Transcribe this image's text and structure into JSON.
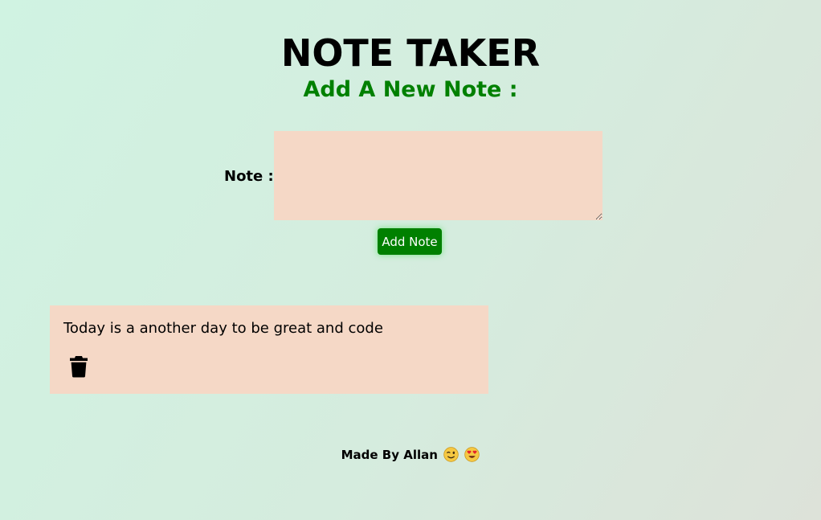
{
  "header": {
    "title": "NOTE TAKER",
    "subtitle": "Add A New Note :"
  },
  "form": {
    "note_label": "Note :",
    "note_value": "",
    "add_button_label": "Add Note"
  },
  "notes": [
    {
      "text": "Today is a another day to be great and code",
      "delete_icon": "trash-icon"
    }
  ],
  "footer": {
    "text": "Made By Allan",
    "emojis": [
      "winking-face-emoji",
      "heart-eyes-emoji"
    ]
  },
  "colors": {
    "title": "#000000",
    "subtitle": "#008000",
    "input_bg": "#f5d8c6",
    "note_card_bg": "#f5d8c6",
    "button_bg": "#008000",
    "button_text": "#ffffff"
  }
}
